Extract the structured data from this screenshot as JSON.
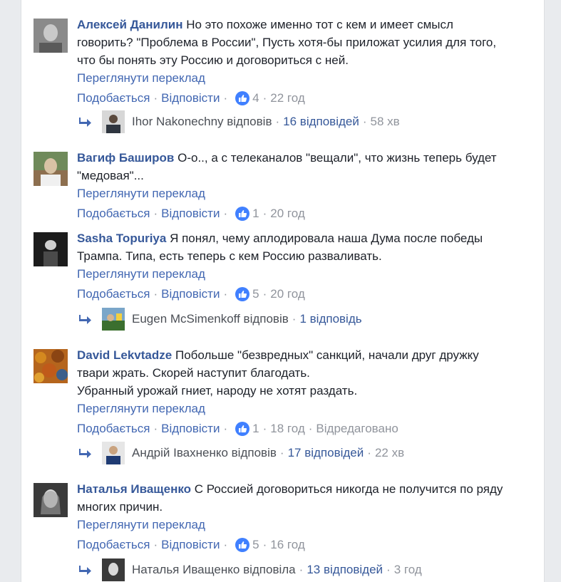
{
  "colors": {
    "link": "#365899",
    "action": "#4267b2",
    "meta": "#90949c",
    "like": "#4080ff"
  },
  "comments": [
    {
      "author": "Алексей Данилин",
      "lines": [
        "Но это похоже именно тот с кем и имеет смысл",
        "говорить? \"Проблема в России\", Пусть хотя-бы приложат усилия для того,",
        "что бы понять эту Россию и договориться с ней."
      ],
      "translate": "Переглянути переклад",
      "like": "Подобається",
      "reply": "Відповісти",
      "likes": "4",
      "time": "22 год",
      "replies": {
        "name": "Ihor Nakonechny відповів",
        "count": "16 відповідей",
        "time": "58 хв"
      }
    },
    {
      "author": "Вагиф Баширов",
      "lines": [
        "О-о.., а с телеканалов \"вещали\", что жизнь теперь будет",
        "\"медовая\"..."
      ],
      "translate": "Переглянути переклад",
      "like": "Подобається",
      "reply": "Відповісти",
      "likes": "1",
      "time": "20 год"
    },
    {
      "author": "Sasha Topuriya",
      "lines": [
        "Я понял, чему аплодировала наша Дума после победы",
        "Трампа. Типа, есть теперь с кем Россию разваливать."
      ],
      "translate": "Переглянути переклад",
      "like": "Подобається",
      "reply": "Відповісти",
      "likes": "5",
      "time": "20 год",
      "replies": {
        "name": "Eugen McSimenkoff відповів",
        "count": "1 відповідь"
      }
    },
    {
      "author": "David Lekvtadze",
      "lines": [
        "Побольше \"безвредных\" санкций, начали друг дружку",
        "твари жрать. Скорей наступит благодать.",
        "Убранный урожай гниет, народу не хотят раздать."
      ],
      "translate": "Переглянути переклад",
      "like": "Подобається",
      "reply": "Відповісти",
      "likes": "1",
      "time": "18 год",
      "edited": "Відредаговано",
      "replies": {
        "name": "Андрій Івахненко відповів",
        "count": "17 відповідей",
        "time": "22 хв"
      }
    },
    {
      "author": "Наталья Иващенко",
      "lines": [
        "С Россией договориться никогда не получится по ряду",
        "многих причин."
      ],
      "translate": "Переглянути переклад",
      "like": "Подобається",
      "reply": "Відповісти",
      "likes": "5",
      "time": "16 год",
      "replies": {
        "name": "Наталья Иващенко відповіла",
        "count": "13 відповідей",
        "time": "3 год"
      }
    }
  ]
}
